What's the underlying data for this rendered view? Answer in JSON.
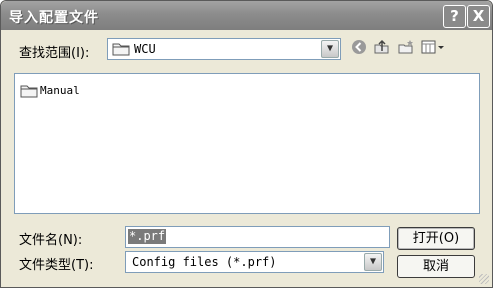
{
  "window": {
    "title": "导入配置文件",
    "help_button": "?",
    "close_button": "X"
  },
  "look_in": {
    "label": "查找范围(I):",
    "value": "WCU"
  },
  "toolbar": {
    "icons": [
      "back-icon",
      "up-folder-icon",
      "new-folder-icon",
      "view-menu-icon"
    ]
  },
  "file_list": {
    "items": [
      {
        "name": "Manual",
        "icon": "folder-icon"
      }
    ]
  },
  "file_name": {
    "label": "文件名(N):",
    "value": "*.prf"
  },
  "file_type": {
    "label": "文件类型(T):",
    "value": "Config files (*.prf)"
  },
  "buttons": {
    "open": "打开(O)",
    "cancel": "取消"
  }
}
